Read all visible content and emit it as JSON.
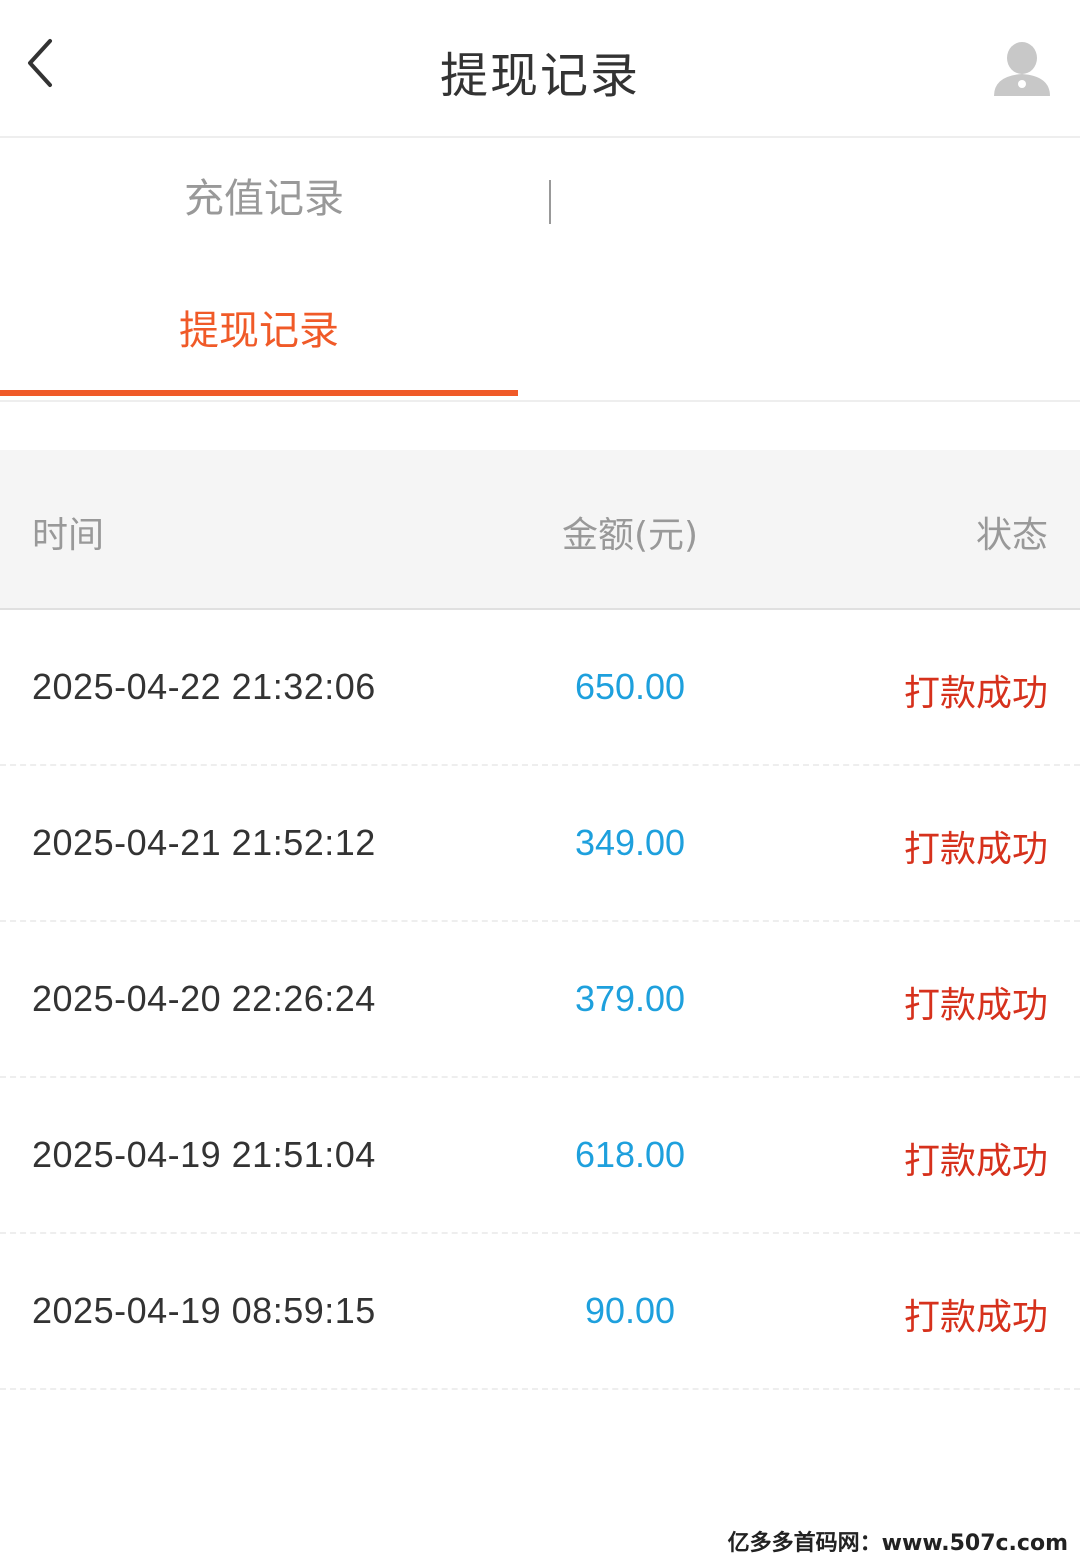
{
  "header": {
    "title": "提现记录",
    "back_icon": "chevron-left-icon",
    "user_icon": "user-icon"
  },
  "tabs": {
    "recharge_label": "充值记录",
    "withdraw_label": "提现记录",
    "active": "withdraw",
    "active_color": "#f05a28"
  },
  "table": {
    "headers": {
      "time": "时间",
      "amount": "金额(元)",
      "status": "状态"
    },
    "rows": [
      {
        "time": "2025-04-22 21:32:06",
        "amount": "650.00",
        "status": "打款成功"
      },
      {
        "time": "2025-04-21 21:52:12",
        "amount": "349.00",
        "status": "打款成功"
      },
      {
        "time": "2025-04-20 22:26:24",
        "amount": "379.00",
        "status": "打款成功"
      },
      {
        "time": "2025-04-19 21:51:04",
        "amount": "618.00",
        "status": "打款成功"
      },
      {
        "time": "2025-04-19 08:59:15",
        "amount": "90.00",
        "status": "打款成功"
      }
    ]
  },
  "colors": {
    "amount": "#1ea0dd",
    "status": "#d6311c"
  },
  "watermark": "亿多多首码网：www.507c.com"
}
